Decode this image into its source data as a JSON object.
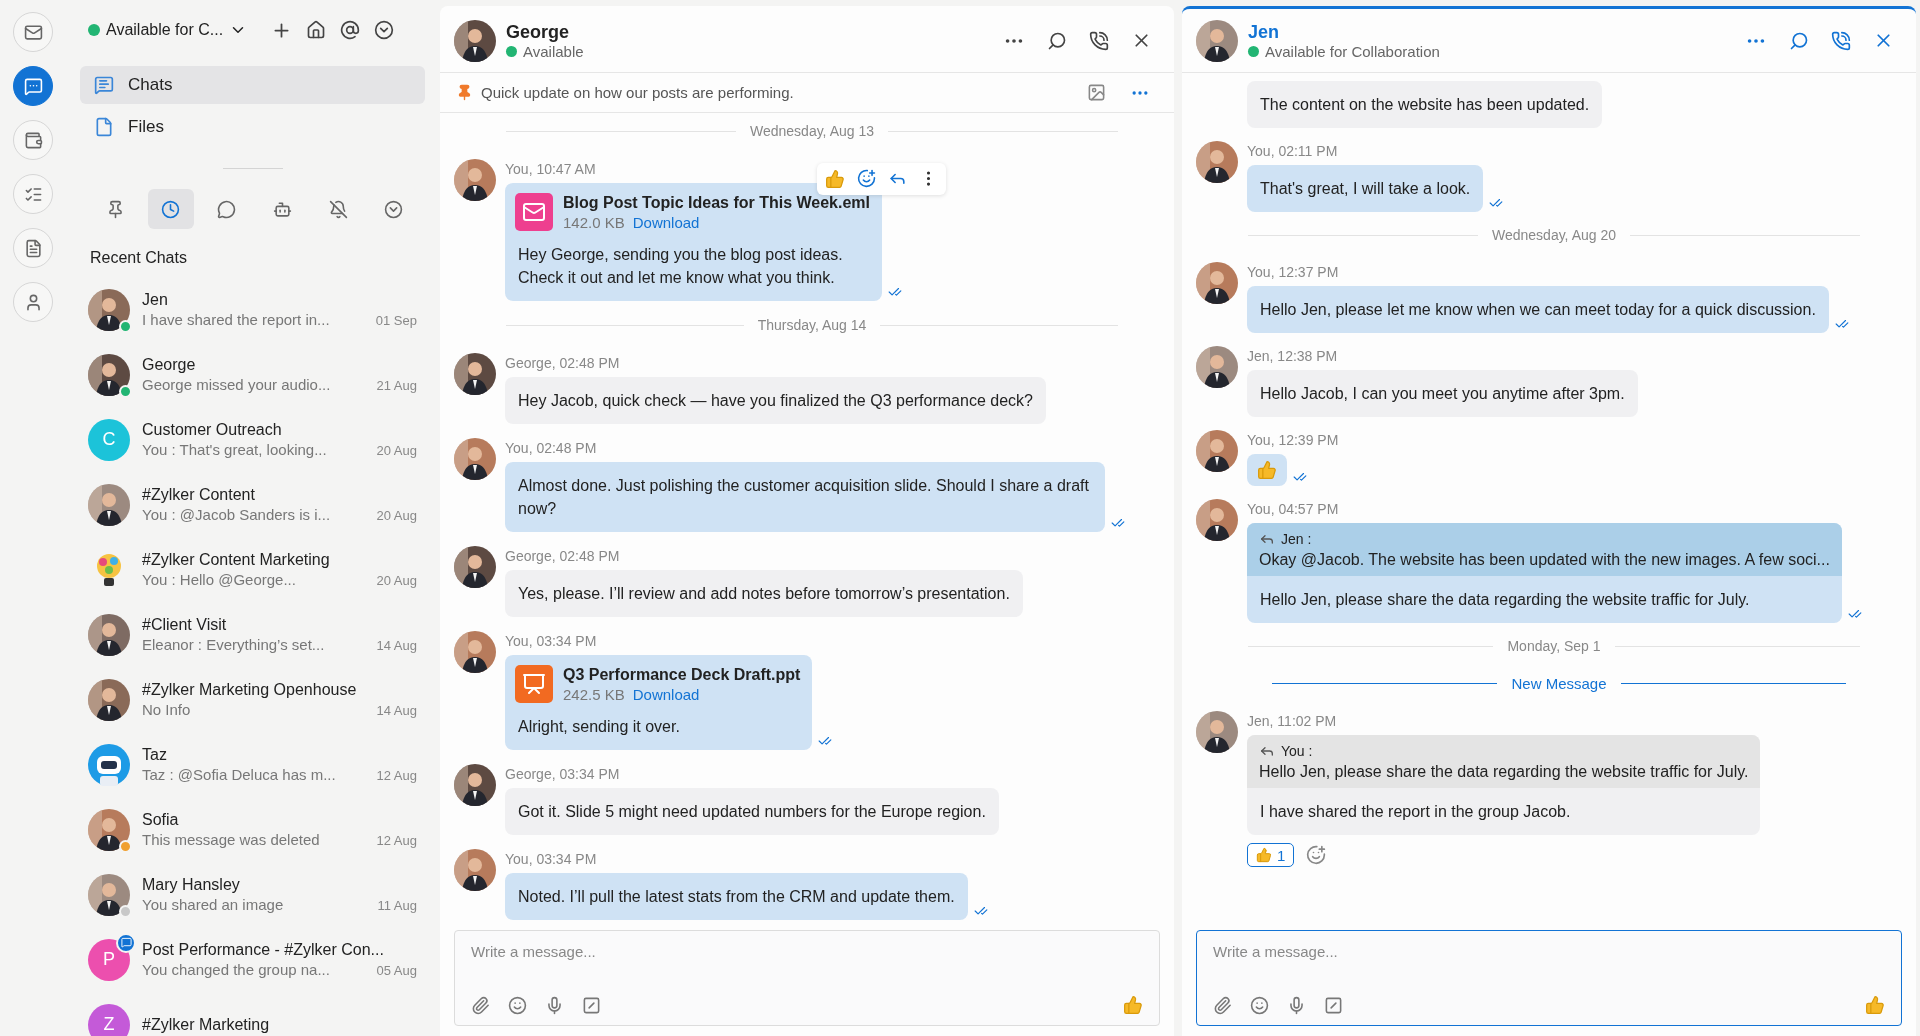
{
  "rail": {
    "items": [
      {
        "kind": "mail",
        "selected": false
      },
      {
        "kind": "chat",
        "selected": true
      },
      {
        "kind": "wallet",
        "selected": false
      },
      {
        "kind": "tasks",
        "selected": false
      },
      {
        "kind": "notes",
        "selected": false
      },
      {
        "kind": "contacts",
        "selected": false
      }
    ]
  },
  "sidebar": {
    "status": {
      "label": "Available for C...",
      "color": "#22b573"
    },
    "nav": [
      {
        "kind": "chat",
        "label": "Chats",
        "selected": true
      },
      {
        "kind": "file",
        "label": "Files",
        "selected": false
      }
    ],
    "filters": [
      {
        "kind": "pin",
        "selected": false
      },
      {
        "kind": "clock",
        "selected": true
      },
      {
        "kind": "chat",
        "selected": false
      },
      {
        "kind": "bot",
        "selected": false
      },
      {
        "kind": "muted",
        "selected": false
      },
      {
        "kind": "more",
        "selected": false
      }
    ],
    "section_title": "Recent Chats",
    "chats": [
      {
        "name": "Jen",
        "preview": "I have shared the report in...",
        "date": "01 Sep",
        "color": "#22b573"
      },
      {
        "name": "George",
        "preview": "George missed your audio...",
        "date": "21 Aug",
        "color": "#22b573"
      },
      {
        "name": "Customer Outreach",
        "preview": "You : That's great, looking...",
        "date": "20 Aug",
        "avatar": {
          "kind": "letter",
          "letter": "C",
          "color": "#1cc3d9"
        }
      },
      {
        "name": "#Zylker Content",
        "preview": "You : @Jacob Sanders  is i...",
        "date": "20 Aug"
      },
      {
        "name": "#Zylker Content Marketing",
        "preview": "You : Hello @George...",
        "date": "20 Aug",
        "avatar": {
          "kind": "bulb"
        }
      },
      {
        "name": "#Client Visit",
        "preview": "Eleanor : Everything’s set...",
        "date": "14 Aug"
      },
      {
        "name": "#Zylker Marketing Openhouse",
        "preview": "No Info",
        "date": "14 Aug"
      },
      {
        "name": "Taz",
        "preview": "Taz : @Sofia Deluca has m...",
        "date": "12 Aug",
        "avatar": {
          "kind": "bot"
        }
      },
      {
        "name": "Sofia",
        "preview": "This message was deleted",
        "date": "12 Aug",
        "color": "#f0a030"
      },
      {
        "name": "Mary Hansley",
        "preview": "You shared an image",
        "date": "11 Aug",
        "color": "#c8c8c8"
      },
      {
        "name": "Post Performance - #Zylker Con...",
        "preview": "You changed the group na...",
        "date": "05 Aug",
        "avatar": {
          "kind": "letter",
          "letter": "P",
          "color": "#ec4fae"
        },
        "badge": true
      },
      {
        "name": "#Zylker Marketing",
        "avatar": {
          "kind": "letter",
          "letter": "Z",
          "color": "#c45ad8"
        }
      }
    ]
  },
  "panels": [
    {
      "focused": false,
      "name": "George",
      "status": "Available",
      "color": "#22b573",
      "pinned": "Quick update on how our posts are performing.",
      "messages": [
        {
          "kind": "date",
          "label": "Wednesday, Aug 13"
        },
        {
          "kind": "message",
          "own": true,
          "meta": "You, 10:47 AM",
          "attachment": {
            "kind": "email",
            "name": "Blog Post Topic Ideas for This Week.eml",
            "size": "142.0 KB",
            "action": "Download"
          },
          "text": "Hey George, sending you the blog post ideas. Check it out and let me know what you think.",
          "read": true,
          "hovered": true
        },
        {
          "kind": "date",
          "label": "Thursday, Aug 14"
        },
        {
          "kind": "message",
          "own": false,
          "meta": "George, 02:48 PM",
          "text": "Hey Jacob, quick check — have you finalized the Q3 performance deck?"
        },
        {
          "kind": "message",
          "own": true,
          "meta": "You, 02:48 PM",
          "text": "Almost done. Just polishing the customer acquisition slide. Should I share a draft now?",
          "read": true
        },
        {
          "kind": "message",
          "own": false,
          "meta": "George, 02:48 PM",
          "text": "Yes, please. I’ll review and add notes before tomorrow’s presentation."
        },
        {
          "kind": "message",
          "own": true,
          "meta": "You, 03:34 PM",
          "attachment": {
            "kind": "slides",
            "name": "Q3 Performance Deck Draft.ppt",
            "size": "242.5 KB",
            "action": "Download"
          },
          "text": "Alright, sending it over.",
          "read": true
        },
        {
          "kind": "message",
          "own": false,
          "meta": "George, 03:34 PM",
          "text": "Got it. Slide 5 might need updated numbers for the Europe region."
        },
        {
          "kind": "message",
          "own": true,
          "meta": "You, 03:34 PM",
          "text": "Noted. I’ll pull the latest stats from the CRM and update them.",
          "read": true
        }
      ],
      "composer": {
        "placeholder": "Write a message..."
      }
    },
    {
      "focused": true,
      "name": "Jen",
      "status": "Available for Collaboration",
      "color": "#22b573",
      "messages": [
        {
          "kind": "continued",
          "own": false,
          "text": "The content on the website has been updated."
        },
        {
          "kind": "message",
          "own": true,
          "meta": "You, 02:11 PM",
          "text": "That's great, I will take a look.",
          "read": true
        },
        {
          "kind": "date",
          "label": "Wednesday, Aug 20"
        },
        {
          "kind": "message",
          "own": true,
          "meta": "You, 12:37 PM",
          "text": "Hello Jen, please let me know when we can meet today for a quick discussion.",
          "read": true
        },
        {
          "kind": "message",
          "own": false,
          "meta": "Jen, 12:38 PM",
          "text": "Hello Jacob, I can you meet you anytime after 3pm."
        },
        {
          "kind": "sticker",
          "own": true,
          "meta": "You, 12:39 PM",
          "read": true
        },
        {
          "kind": "message",
          "own": true,
          "meta": "You, 04:57 PM",
          "quote": {
            "author": "Jen :",
            "text": "Okay @Jacob. The website has been updated with the new images. A few soci..."
          },
          "text": "Hello Jen, please share the data regarding the website traffic for July.",
          "read": true
        },
        {
          "kind": "date",
          "label": "Monday, Sep 1"
        },
        {
          "kind": "new",
          "label": "New Message"
        },
        {
          "kind": "message",
          "own": false,
          "meta": "Jen, 11:02 PM",
          "quote": {
            "author": "You :",
            "text": "Hello Jen, please share the data regarding the website traffic for July."
          },
          "text": "I have shared the report in the group Jacob.",
          "reactions": [
            {
              "count": "1",
              "mine": true
            }
          ]
        }
      ],
      "composer": {
        "placeholder": "Write a message..."
      }
    }
  ]
}
